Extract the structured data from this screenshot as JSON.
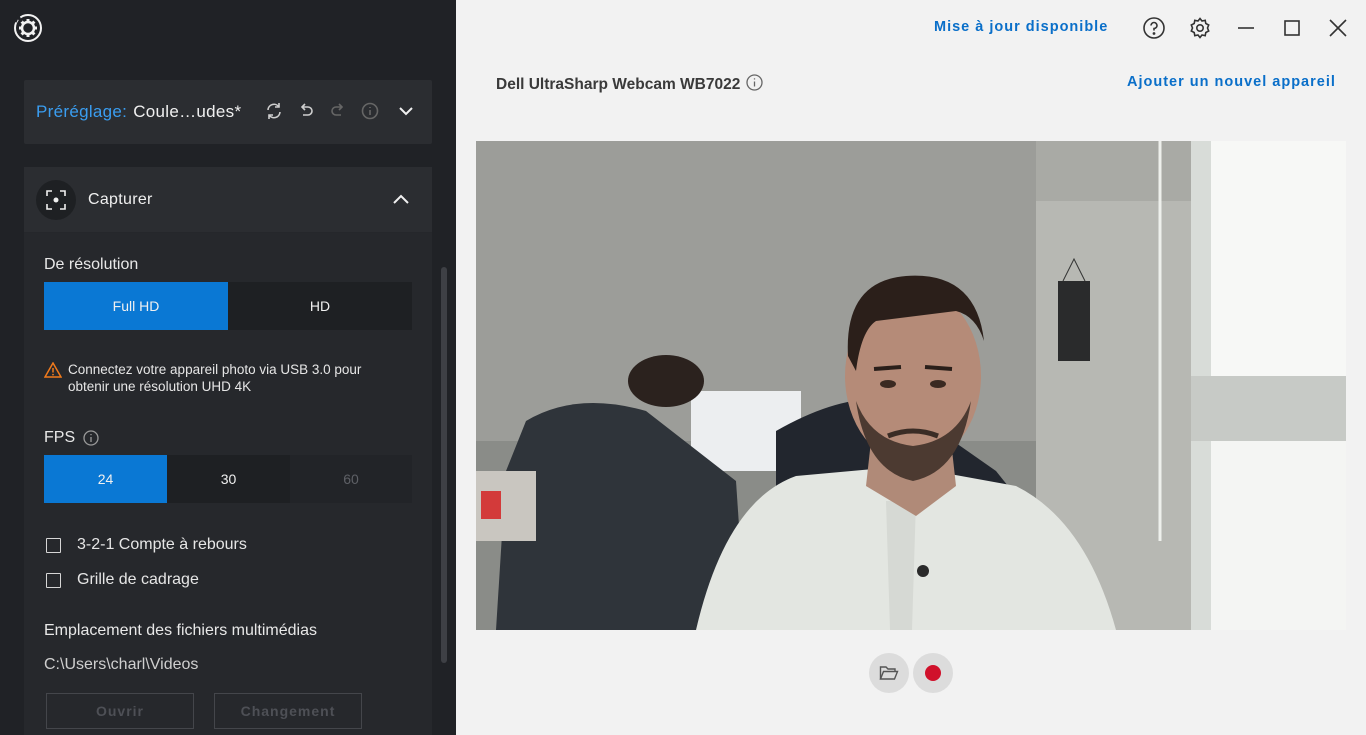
{
  "preset": {
    "label": "Préréglage:",
    "value": "Coule…udes*"
  },
  "capture": {
    "title": "Capturer",
    "resolution_label": "De résolution",
    "resolution_options": [
      "Full HD",
      "HD"
    ],
    "resolution_selected": "Full HD",
    "warning": "Connectez votre appareil photo via USB 3.0 pour obtenir une résolution UHD 4K",
    "fps_label": "FPS",
    "fps_options": [
      "24",
      "30",
      "60"
    ],
    "fps_selected": "24",
    "countdown_label": "3-2-1 Compte à rebours",
    "countdown_checked": false,
    "grid_label": "Grille de cadrage",
    "grid_checked": false,
    "media_location_label": "Emplacement des fichiers multimédias",
    "media_path": "C:\\Users\\charl\\Videos",
    "open_button": "Ouvrir",
    "change_button": "Changement"
  },
  "header": {
    "update_link": "Mise à jour disponible"
  },
  "device": {
    "name": "Dell UltraSharp Webcam WB7022",
    "add_device_link": "Ajouter un nouvel appareil"
  },
  "colors": {
    "accent": "#0a78d4",
    "sidebar_bg": "#202226",
    "record": "#d0112b"
  }
}
